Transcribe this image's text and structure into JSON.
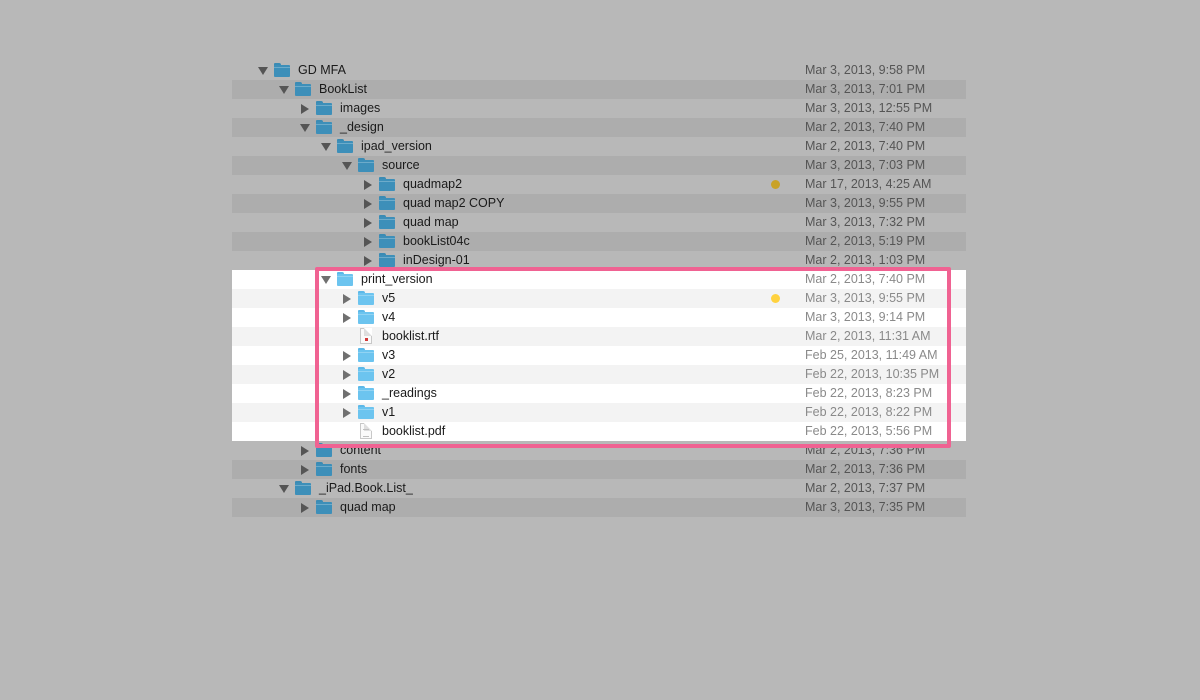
{
  "colors": {
    "background": "#b8b8b8",
    "highlight_border": "#f06292",
    "tag_dim": "#c9a227",
    "tag_bright": "#ffd23f"
  },
  "rows": [
    {
      "name": "GD MFA",
      "date": "Mar 3, 2013, 9:58 PM",
      "level": 0,
      "expanded": true,
      "kind": "folder"
    },
    {
      "name": "BookList",
      "date": "Mar 3, 2013, 7:01 PM",
      "level": 1,
      "expanded": true,
      "kind": "folder"
    },
    {
      "name": "images",
      "date": "Mar 3, 2013, 12:55 PM",
      "level": 2,
      "expanded": false,
      "kind": "folder"
    },
    {
      "name": "_design",
      "date": "Mar 2, 2013, 7:40 PM",
      "level": 2,
      "expanded": true,
      "kind": "folder"
    },
    {
      "name": "ipad_version",
      "date": "Mar 2, 2013, 7:40 PM",
      "level": 3,
      "expanded": true,
      "kind": "folder"
    },
    {
      "name": "source",
      "date": "Mar 3, 2013, 7:03 PM",
      "level": 4,
      "expanded": true,
      "kind": "folder"
    },
    {
      "name": "quadmap2",
      "date": "Mar 17, 2013, 4:25 AM",
      "level": 5,
      "expanded": false,
      "kind": "folder",
      "tag": "tag_dim"
    },
    {
      "name": "quad map2 COPY",
      "date": "Mar 3, 2013, 9:55 PM",
      "level": 5,
      "expanded": false,
      "kind": "folder"
    },
    {
      "name": "quad map",
      "date": "Mar 3, 2013, 7:32 PM",
      "level": 5,
      "expanded": false,
      "kind": "folder"
    },
    {
      "name": "bookList04c",
      "date": "Mar 2, 2013, 5:19 PM",
      "level": 5,
      "expanded": false,
      "kind": "folder"
    },
    {
      "name": "inDesign-01",
      "date": "Mar 2, 2013, 1:03 PM",
      "level": 5,
      "expanded": false,
      "kind": "folder"
    },
    {
      "name": "print_version",
      "date": "Mar 2, 2013, 7:40 PM",
      "level": 3,
      "expanded": true,
      "kind": "folder",
      "hl": true
    },
    {
      "name": "v5",
      "date": "Mar 3, 2013, 9:55 PM",
      "level": 4,
      "expanded": false,
      "kind": "folder",
      "hl": true,
      "tag": "tag_bright"
    },
    {
      "name": "v4",
      "date": "Mar 3, 2013, 9:14 PM",
      "level": 4,
      "expanded": false,
      "kind": "folder",
      "hl": true
    },
    {
      "name": "booklist.rtf",
      "date": "Mar 2, 2013, 11:31 AM",
      "level": 4,
      "kind": "rtf",
      "hl": true
    },
    {
      "name": "v3",
      "date": "Feb 25, 2013, 11:49 AM",
      "level": 4,
      "expanded": false,
      "kind": "folder",
      "hl": true
    },
    {
      "name": "v2",
      "date": "Feb 22, 2013, 10:35 PM",
      "level": 4,
      "expanded": false,
      "kind": "folder",
      "hl": true
    },
    {
      "name": "_readings",
      "date": "Feb 22, 2013, 8:23 PM",
      "level": 4,
      "expanded": false,
      "kind": "folder",
      "hl": true
    },
    {
      "name": "v1",
      "date": "Feb 22, 2013, 8:22 PM",
      "level": 4,
      "expanded": false,
      "kind": "folder",
      "hl": true
    },
    {
      "name": "booklist.pdf",
      "date": "Feb 22, 2013, 5:56 PM",
      "level": 4,
      "kind": "pdf",
      "hl": true
    },
    {
      "name": "content",
      "date": "Mar 2, 2013, 7:36 PM",
      "level": 2,
      "expanded": false,
      "kind": "folder"
    },
    {
      "name": "fonts",
      "date": "Mar 2, 2013, 7:36 PM",
      "level": 2,
      "expanded": false,
      "kind": "folder"
    },
    {
      "name": "_iPad.Book.List_",
      "date": "Mar 2, 2013, 7:37 PM",
      "level": 1,
      "expanded": true,
      "kind": "folder"
    },
    {
      "name": "quad map",
      "date": "Mar 3, 2013, 7:35 PM",
      "level": 2,
      "expanded": false,
      "kind": "folder"
    }
  ]
}
